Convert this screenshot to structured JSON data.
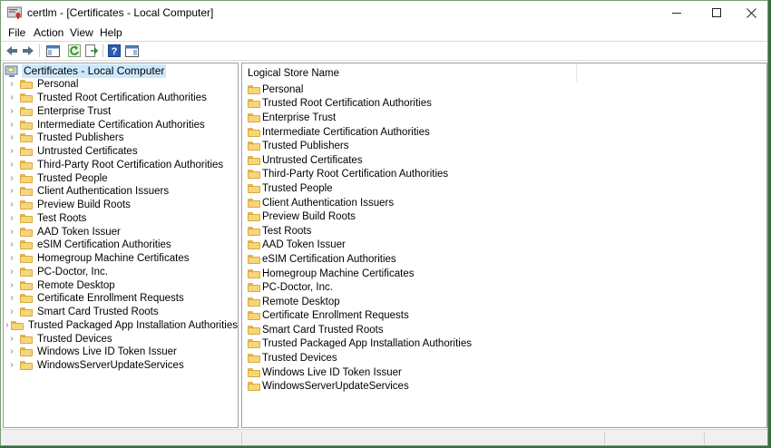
{
  "window": {
    "title": "certlm - [Certificates - Local Computer]",
    "app_icon": "certificate-app-icon"
  },
  "menu": [
    "File",
    "Action",
    "View",
    "Help"
  ],
  "toolbar": {
    "buttons": [
      "back-arrow-icon",
      "forward-arrow-icon",
      "show-hide-console-tree-icon",
      "refresh-icon",
      "export-list-icon",
      "help-icon",
      "show-action-pane-icon"
    ]
  },
  "tree": {
    "root_label": "Certificates - Local Computer",
    "items": [
      "Personal",
      "Trusted Root Certification Authorities",
      "Enterprise Trust",
      "Intermediate Certification Authorities",
      "Trusted Publishers",
      "Untrusted Certificates",
      "Third-Party Root Certification Authorities",
      "Trusted People",
      "Client Authentication Issuers",
      "Preview Build Roots",
      "Test Roots",
      "AAD Token Issuer",
      "eSIM Certification Authorities",
      "Homegroup Machine Certificates",
      "PC-Doctor, Inc.",
      "Remote Desktop",
      "Certificate Enrollment Requests",
      "Smart Card Trusted Roots",
      "Trusted Packaged App Installation Authorities",
      "Trusted Devices",
      "Windows Live ID Token Issuer",
      "WindowsServerUpdateServices"
    ]
  },
  "list": {
    "column_header": "Logical Store Name",
    "items": [
      "Personal",
      "Trusted Root Certification Authorities",
      "Enterprise Trust",
      "Intermediate Certification Authorities",
      "Trusted Publishers",
      "Untrusted Certificates",
      "Third-Party Root Certification Authorities",
      "Trusted People",
      "Client Authentication Issuers",
      "Preview Build Roots",
      "Test Roots",
      "AAD Token Issuer",
      "eSIM Certification Authorities",
      "Homegroup Machine Certificates",
      "PC-Doctor, Inc.",
      "Remote Desktop",
      "Certificate Enrollment Requests",
      "Smart Card Trusted Roots",
      "Trusted Packaged App Installation Authorities",
      "Trusted Devices",
      "Windows Live ID Token Issuer",
      "WindowsServerUpdateServices"
    ]
  },
  "colors": {
    "selection": "#cce8ff",
    "folder": "#f7d57a",
    "desktop": "#3a6e3f"
  }
}
